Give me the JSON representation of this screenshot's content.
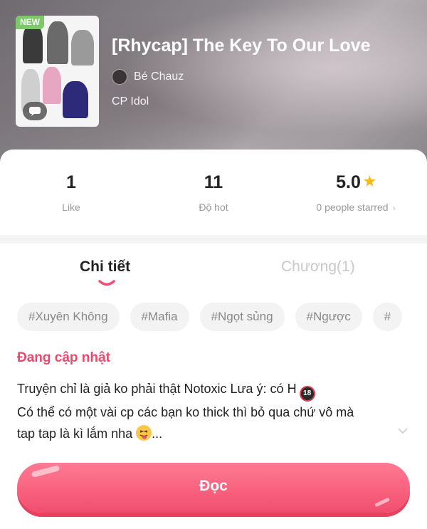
{
  "story": {
    "badge": "NEW",
    "title": "[Rhycap] The Key To Our Love",
    "author": "Bé Chauz",
    "category": "CP Idol"
  },
  "stats": {
    "likes": {
      "value": "1",
      "label": "Like"
    },
    "hot": {
      "value": "11",
      "label": "Độ hot"
    },
    "rating": {
      "value": "5.0",
      "label": "0 people starred"
    }
  },
  "tabs": [
    {
      "label": "Chi tiết",
      "active": true
    },
    {
      "label": "Chương(1)",
      "active": false
    }
  ],
  "tags": [
    "#Xuyên Không",
    "#Mafia",
    "#Ngọt sủng",
    "#Ngược",
    "#"
  ],
  "status": "Đang cập nhật",
  "description": {
    "line1": "Truyện chỉ là giả ko phải thật  Notoxic Lưa ý: có H",
    "line2": "Có thể có một vài cp các bạn ko thick thì bỏ qua chứ vô mà",
    "line3": "tap tap là kì lắm nha",
    "ellipsis": "...",
    "badge_18": "18"
  },
  "read_button": "Đọc",
  "colors": {
    "accent": "#f24e6f",
    "status": "#e84a6e",
    "star": "#f5b719",
    "new_badge": "#7dc86a"
  }
}
